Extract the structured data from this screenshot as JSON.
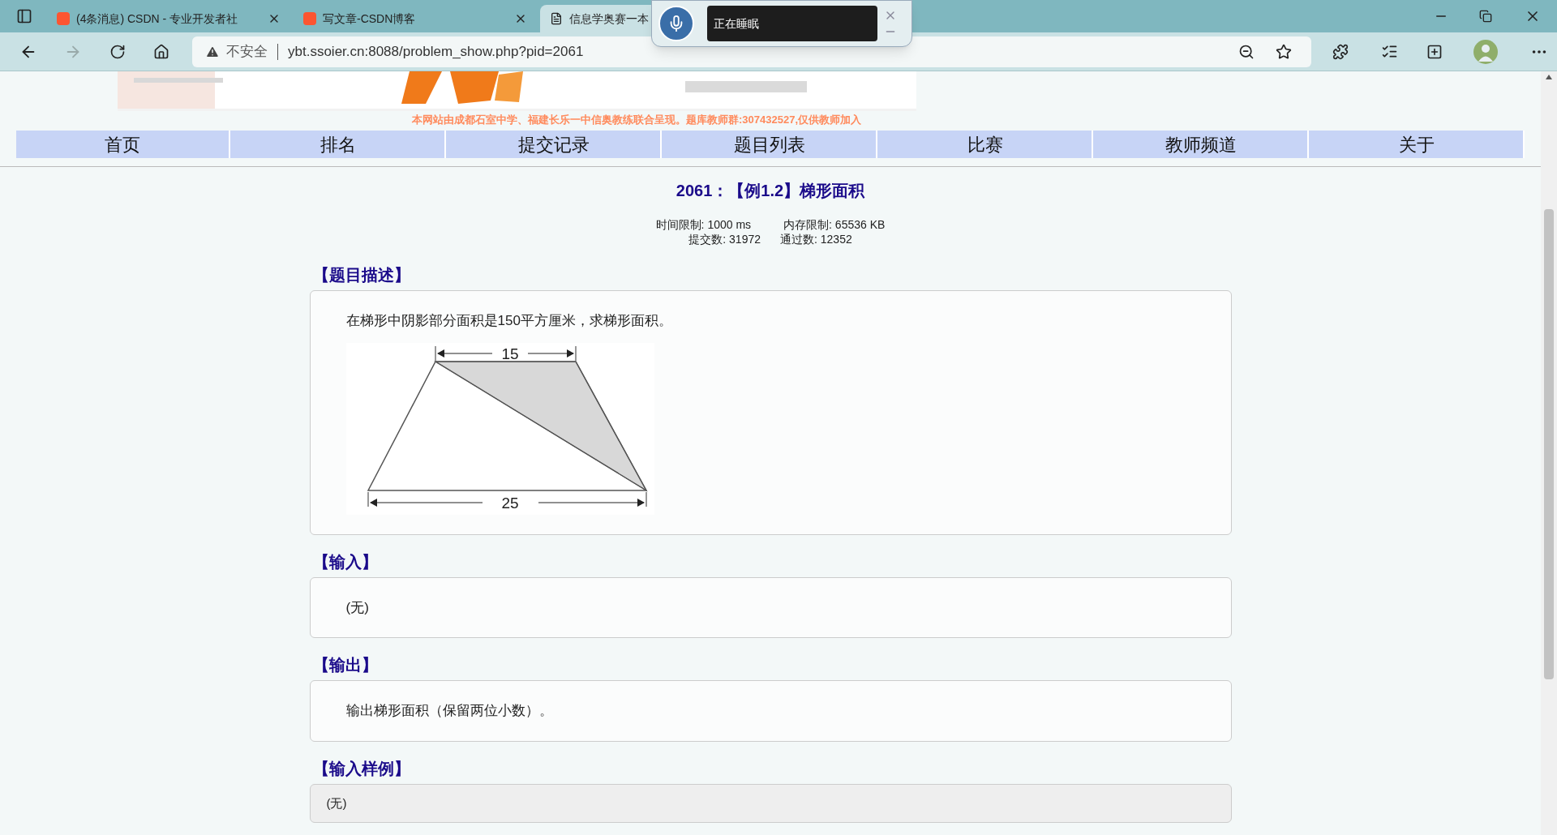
{
  "browser": {
    "tabs": [
      {
        "title": "(4条消息) CSDN - 专业开发者社",
        "kind": "csdn",
        "selected": false
      },
      {
        "title": "写文章-CSDN博客",
        "kind": "csdn",
        "selected": false
      },
      {
        "title": "信息学奥赛一本",
        "kind": "page",
        "selected": true
      }
    ],
    "security": "不安全",
    "url": "ybt.ssoier.cn:8088/problem_show.php?pid=2061"
  },
  "voice_popup": {
    "status": "正在睡眠"
  },
  "site": {
    "notice": "本网站由成都石室中学、福建长乐一中信奥教练联合呈现。题库教师群:307432527,仅供教师加入",
    "nav": [
      {
        "label": "首页"
      },
      {
        "label": "排名"
      },
      {
        "label": "提交记录"
      },
      {
        "label": "题目列表"
      },
      {
        "label": "比赛"
      },
      {
        "label": "教师频道"
      },
      {
        "label": "关于"
      }
    ]
  },
  "problem": {
    "title": "2061：【例1.2】梯形面积",
    "limits": [
      {
        "label": "时间限制: 1000 ms"
      },
      {
        "label": "内存限制: 65536 KB"
      }
    ],
    "stats": [
      {
        "label": "提交数: 31972"
      },
      {
        "label": "通过数: 12352"
      }
    ],
    "sections": [
      {
        "heading": "【题目描述】",
        "kind": "text",
        "text": "在梯形中阴影部分面积是150平方厘米，求梯形面积。",
        "figure": {
          "top_label": "15",
          "bottom_label": "25"
        }
      },
      {
        "heading": "【输入】",
        "kind": "text",
        "text": "(无)"
      },
      {
        "heading": "【输出】",
        "kind": "text",
        "text": "输出梯形面积（保留两位小数）。"
      },
      {
        "heading": "【输入样例】",
        "kind": "code",
        "text": "(无)"
      }
    ]
  }
}
